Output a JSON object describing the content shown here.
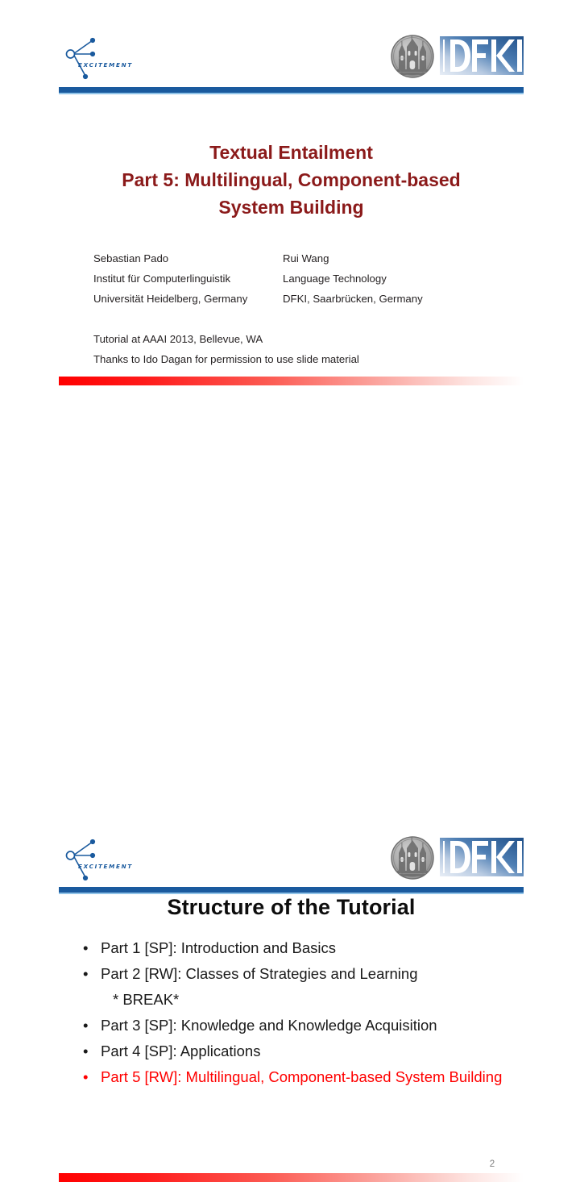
{
  "page": {
    "background": "#ffffff",
    "accent_blue": "#1a5a9e",
    "accent_red": "#ff0000",
    "title_dark_red": "#8b1a1a"
  },
  "slide1": {
    "header": {
      "left_logo_word": "EXCITEMENT",
      "left_logo_icon": "excitement-network-icon",
      "right_seal_icon": "university-heidelberg-seal-icon",
      "right_logo_text": "DFKI"
    },
    "title_lines": [
      "Textual Entailment",
      "Part 5: Multilingual, Component-based",
      "System Building"
    ],
    "authors": [
      {
        "left": "Sebastian Pado",
        "right": "Rui Wang"
      },
      {
        "left": "Institut für Computerlinguistik",
        "right": "Language Technology"
      },
      {
        "left": "Universität Heidelberg, Germany",
        "right": "DFKI, Saarbrücken, Germany"
      }
    ],
    "meta_lines": [
      "Tutorial at AAAI 2013, Bellevue, WA",
      "Thanks to Ido Dagan for permission to use slide material"
    ]
  },
  "slide2": {
    "header": {
      "left_logo_word": "EXCITEMENT",
      "left_logo_icon": "excitement-network-icon",
      "right_seal_icon": "university-heidelberg-seal-icon",
      "right_logo_text": "DFKI"
    },
    "heading": "Structure of the Tutorial",
    "bullets": [
      {
        "text": "Part 1 [SP]: Introduction and Basics",
        "bullet": "•",
        "style": "normal"
      },
      {
        "text": "Part 2 [RW]: Classes of Strategies and Learning",
        "bullet": "•",
        "style": "normal"
      },
      {
        "text": "* BREAK*",
        "bullet": "",
        "style": "no-bullet"
      },
      {
        "text": "Part 3 [SP]: Knowledge and Knowledge Acquisition",
        "bullet": "•",
        "style": "normal"
      },
      {
        "text": "Part 4 [SP]: Applications",
        "bullet": "•",
        "style": "normal"
      },
      {
        "text": "Part 5 [RW]: Multilingual, Component-based System Building",
        "bullet": "•",
        "style": "accent"
      }
    ],
    "page_number": "2"
  }
}
